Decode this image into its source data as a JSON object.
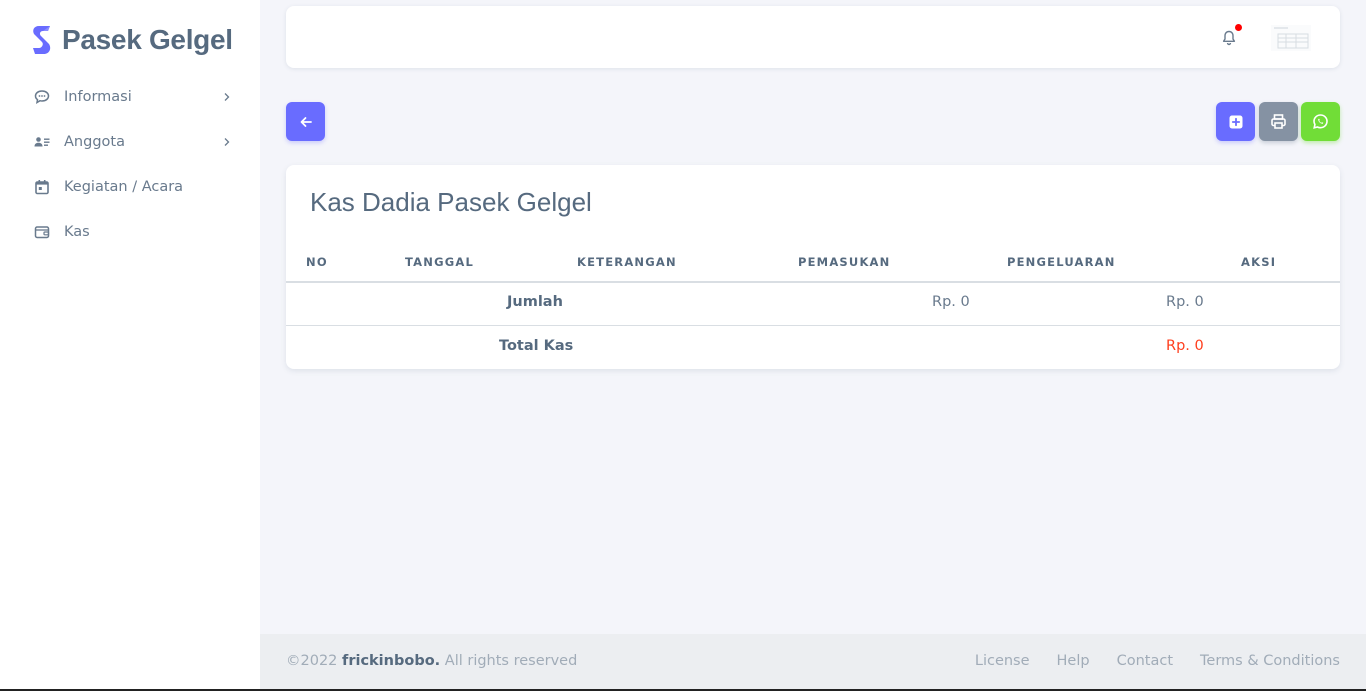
{
  "brand": {
    "name": "Pasek Gelgel",
    "logo_icon": "brand-s-logo",
    "logo_color": "#696cff"
  },
  "sidebar": {
    "items": [
      {
        "label": "Informasi",
        "icon": "chat-bubble-icon",
        "has_submenu": true
      },
      {
        "label": "Anggota",
        "icon": "users-list-icon",
        "has_submenu": true
      },
      {
        "label": "Kegiatan / Acara",
        "icon": "calendar-icon",
        "has_submenu": false
      },
      {
        "label": "Kas",
        "icon": "wallet-icon",
        "has_submenu": false
      }
    ]
  },
  "navbar": {
    "notification_icon": "bell-icon",
    "notification_dot_color": "#ff0000",
    "avatar": "user-avatar"
  },
  "actions": {
    "back_icon": "arrow-left-icon",
    "add_icon": "plus-square-icon",
    "print_icon": "printer-icon",
    "whatsapp_icon": "whatsapp-icon",
    "colors": {
      "primary": "#696cff",
      "secondary": "#8592a3",
      "success": "#71dd37"
    }
  },
  "card": {
    "title": "Kas Dadia Pasek Gelgel",
    "table": {
      "headers": [
        "NO",
        "TANGGAL",
        "KETERANGAN",
        "PEMASUKAN",
        "PENGELUARAN",
        "AKSI"
      ],
      "rows": [],
      "summary": {
        "jumlah_label": "Jumlah",
        "jumlah_pemasukan": "Rp. 0",
        "jumlah_pengeluaran": "Rp. 0",
        "total_label": "Total Kas",
        "total_value": "Rp. 0",
        "total_color": "#ff3e1d"
      }
    }
  },
  "footer": {
    "year": "©2022",
    "author": "frickinbobo.",
    "rights": "All rights reserved",
    "links": [
      "License",
      "Help",
      "Contact",
      "Terms & Conditions"
    ]
  }
}
